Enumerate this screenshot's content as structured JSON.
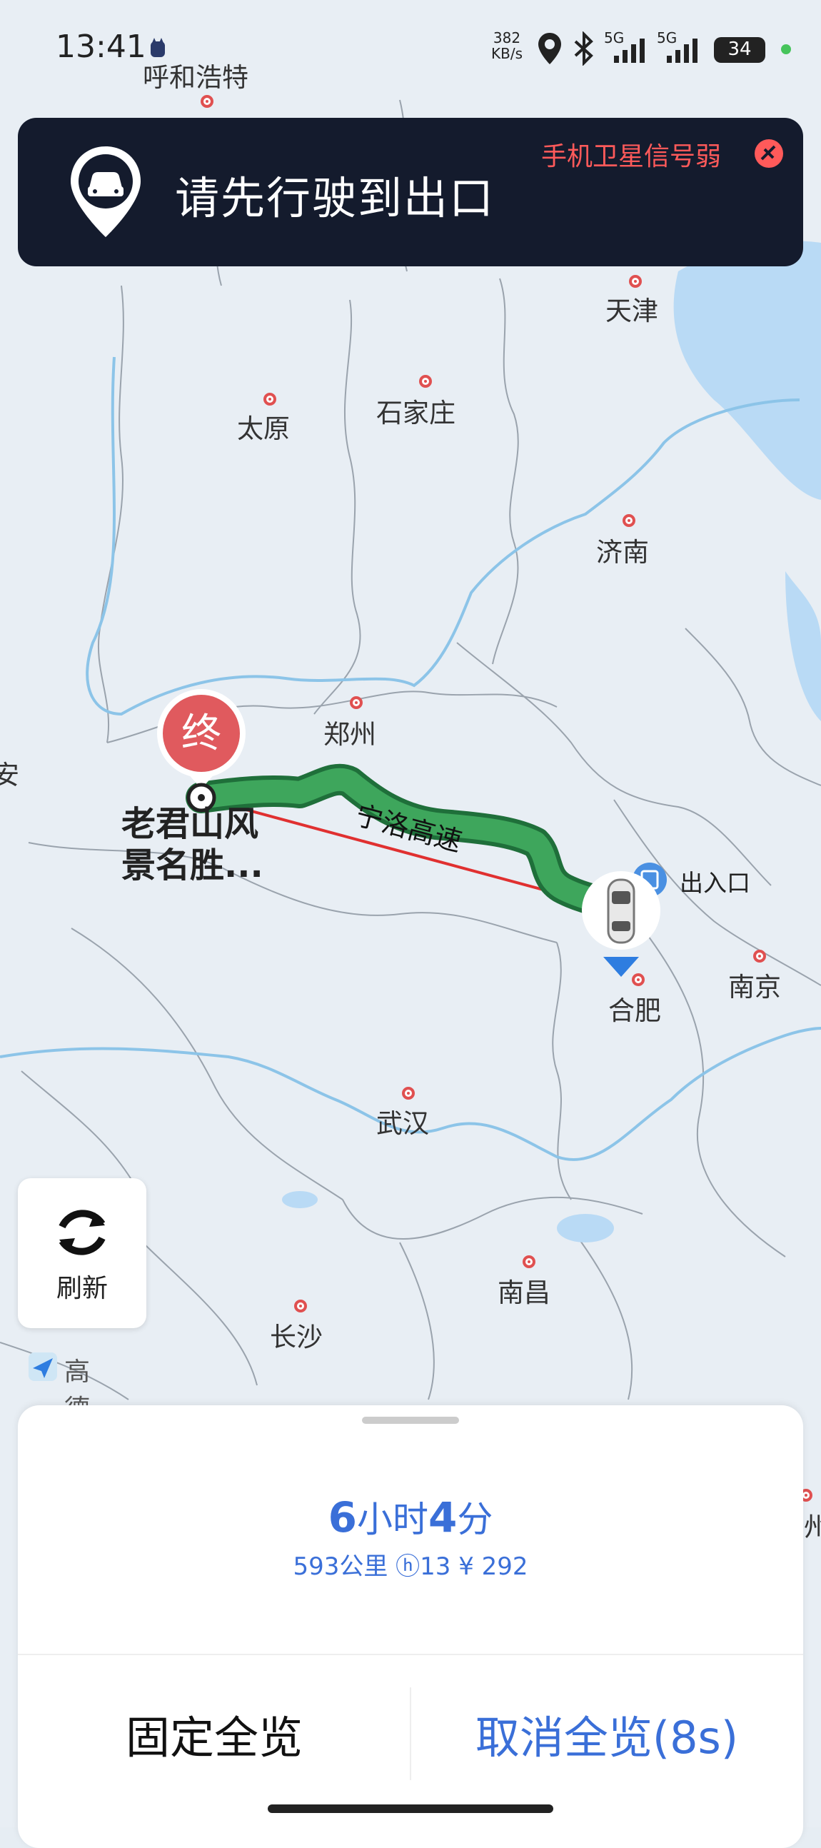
{
  "status_bar": {
    "time": "13:41",
    "speed_value": "382",
    "speed_unit": "KB/s",
    "network_1": "5G",
    "network_2": "5G",
    "battery": "34"
  },
  "banner": {
    "title": "请先行驶到出口",
    "warning": "手机卫星信号弱"
  },
  "map": {
    "cities": [
      {
        "name": "呼和浩特"
      },
      {
        "name": "天津"
      },
      {
        "name": "太原"
      },
      {
        "name": "石家庄"
      },
      {
        "name": "济南"
      },
      {
        "name": "郑州"
      },
      {
        "name": "合肥"
      },
      {
        "name": "南京"
      },
      {
        "name": "武汉"
      },
      {
        "name": "南昌"
      },
      {
        "name": "长沙"
      },
      {
        "name": "安"
      },
      {
        "name": "州"
      }
    ],
    "route_label": "宁洛高速",
    "destination_marker": "终",
    "destination_name_line1": "老君山风",
    "destination_name_line2": "景名胜...",
    "exit_label": "出入口",
    "colors": {
      "route": "#2f9a4f",
      "line": "#e03030",
      "marker": "#e05050"
    }
  },
  "refresh": {
    "label": "刷新"
  },
  "logo": {
    "text": "高德地图"
  },
  "sheet": {
    "duration_hours": "6",
    "hours_unit": "小时",
    "duration_minutes": "4",
    "minutes_unit": "分",
    "meta": "593公里  ⓗ13  ¥ 292",
    "fix_overview": "固定全览",
    "cancel_overview": "取消全览(8s)"
  }
}
